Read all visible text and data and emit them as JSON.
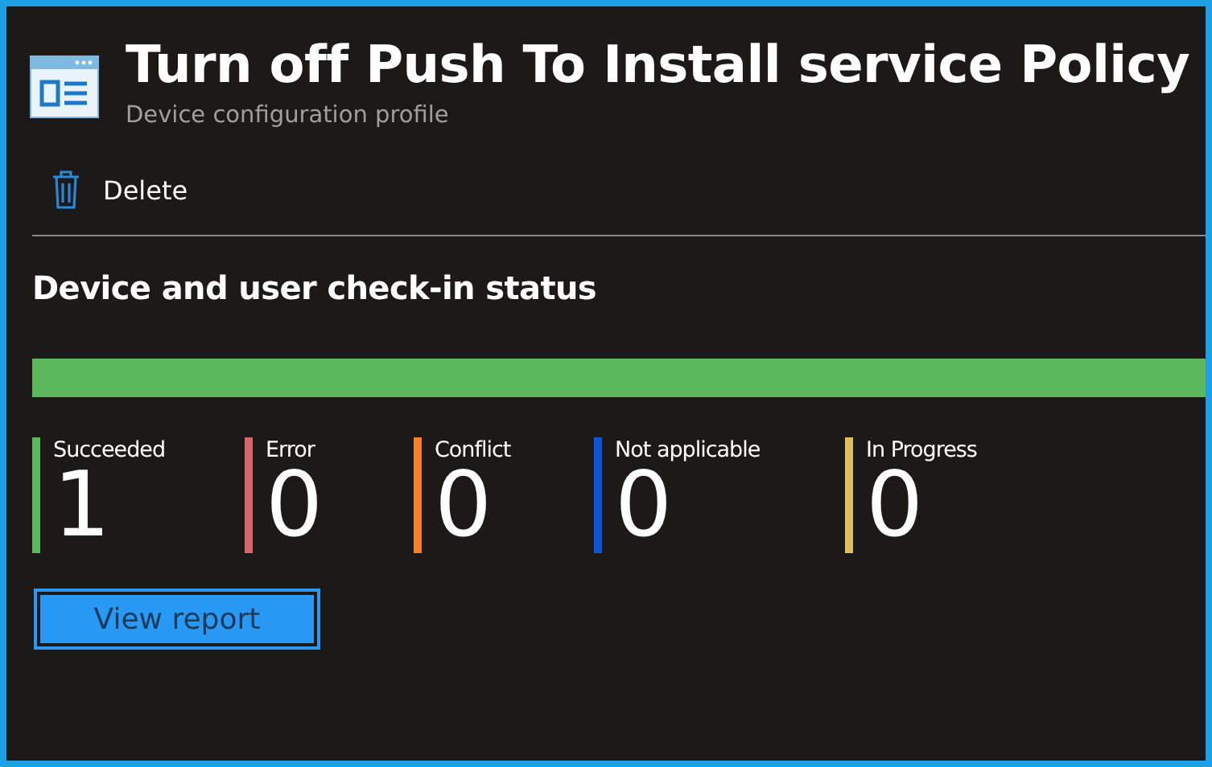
{
  "header": {
    "title": "Turn off Push To Install service Policy",
    "subtitle": "Device configuration profile"
  },
  "toolbar": [
    {
      "label": "Delete"
    }
  ],
  "status": {
    "title": "Device and user check-in status",
    "level": 1.0,
    "stats": [
      {
        "label": "Succeeded",
        "count": "1",
        "color": "#5cb85c"
      },
      {
        "label": "Error",
        "count": "0",
        "color": "#d9646c"
      },
      {
        "label": "Conflict",
        "count": "0",
        "color": "#f7812b"
      },
      {
        "label": "Not applicable",
        "count": "0",
        "color": "#0a58d6"
      },
      {
        "label": "In Progress",
        "count": "0",
        "color": "#dcc15a"
      }
    ],
    "button": "View report"
  }
}
